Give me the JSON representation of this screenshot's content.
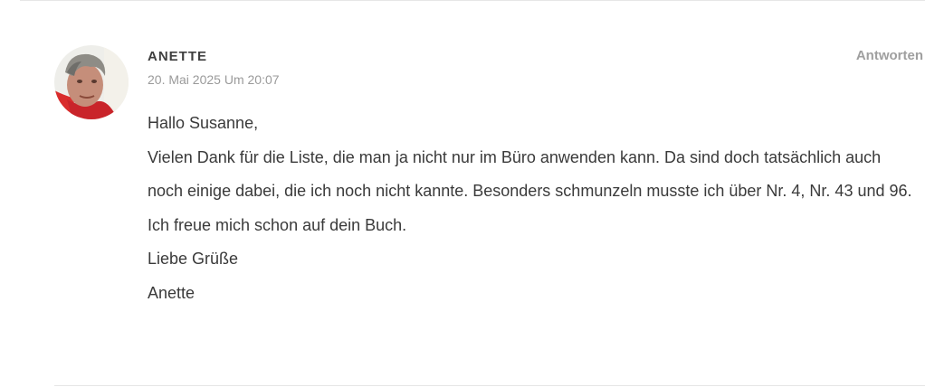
{
  "comment": {
    "author": "ANETTE",
    "date": "20. Mai 2025 Um 20:07",
    "reply_label": "Antworten",
    "avatar_icon": "user-photo-avatar",
    "paragraphs": [
      "Hallo Susanne,",
      "Vielen Dank für die Liste, die man ja nicht nur im Büro anwenden kann. Da sind doch tatsächlich auch noch einige dabei, die ich noch nicht kannte. Besonders schmunzeln musste ich über Nr. 4, Nr. 43 und 96. Ich freue mich schon auf dein Buch.",
      "Liebe Grüße",
      "Anette"
    ]
  },
  "colors": {
    "text": "#3a3a3a",
    "meta": "#9a9a9a",
    "divider": "#e6e6e6"
  }
}
